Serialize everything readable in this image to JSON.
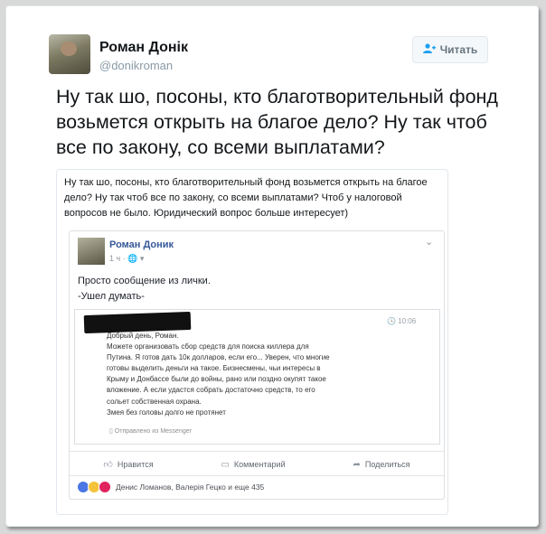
{
  "tweet": {
    "author_name": "Роман Донік",
    "author_handle": "@donikroman",
    "follow_label": "Читать",
    "text": "Ну так шо, посоны, кто благотворительный фонд возьмется открыть на благое дело? Ну так чтоб все по закону, со всеми выплатами?"
  },
  "quote": {
    "text": "Ну так шо, посоны, кто благотворительный фонд возьмется открыть на благое дело? Ну так чтоб все по закону, со всеми выплатами? Чтоб у налоговой вопросов не было. Юридический вопрос больше интересует)"
  },
  "fb_post": {
    "author": "Роман Доник",
    "meta": "1 ч · 🌐 ▾",
    "text_line1": "Просто сообщение из лички.",
    "text_line2": "-Ушел думать-",
    "message": {
      "time": "🕓 10:06",
      "lines": [
        "Добрый день, Роман.",
        "Можете организовать сбор средств для поиска киллера для",
        "Путина. Я готов дать 10к долларов, если его... Уверен, что многие",
        "готовы выделить деньги на такое. Бизнесмены, чьи интересы в",
        "Крыму и Донбассе были до войны, рано или поздно окупят такое",
        "вложение. А если удастся собрать достаточно средств, то его",
        "сольет собственная охрана.",
        "Змея без головы долго не протянет"
      ],
      "sent_via": "Отправлено из Messenger"
    },
    "actions": {
      "like": "Нравится",
      "comment": "Комментарий",
      "share": "Поделиться"
    },
    "reactions_text": "Денис Ломанов, Валерія Гецко и еще 435"
  }
}
